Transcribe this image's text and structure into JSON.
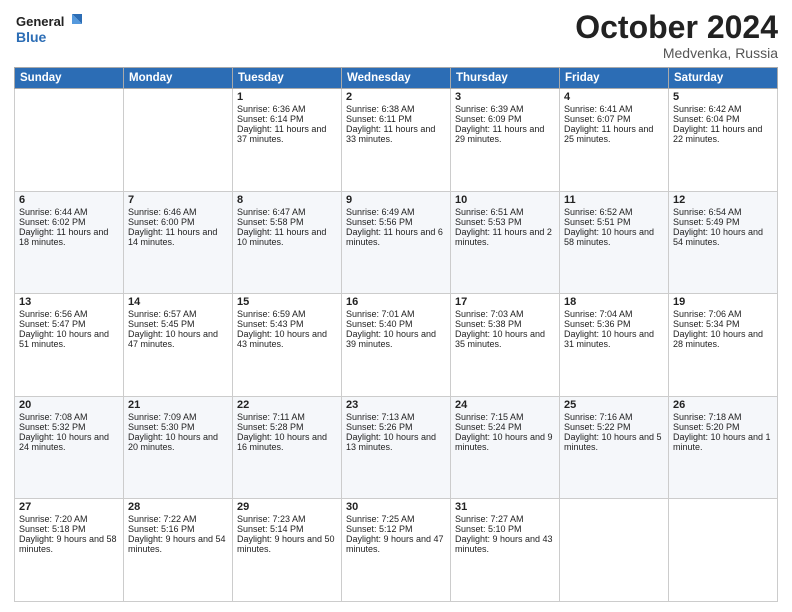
{
  "header": {
    "logo_line1": "General",
    "logo_line2": "Blue",
    "month": "October 2024",
    "location": "Medvenka, Russia"
  },
  "weekdays": [
    "Sunday",
    "Monday",
    "Tuesday",
    "Wednesday",
    "Thursday",
    "Friday",
    "Saturday"
  ],
  "weeks": [
    [
      {
        "day": "",
        "info": ""
      },
      {
        "day": "",
        "info": ""
      },
      {
        "day": "1",
        "info": "Sunrise: 6:36 AM\nSunset: 6:14 PM\nDaylight: 11 hours and 37 minutes."
      },
      {
        "day": "2",
        "info": "Sunrise: 6:38 AM\nSunset: 6:11 PM\nDaylight: 11 hours and 33 minutes."
      },
      {
        "day": "3",
        "info": "Sunrise: 6:39 AM\nSunset: 6:09 PM\nDaylight: 11 hours and 29 minutes."
      },
      {
        "day": "4",
        "info": "Sunrise: 6:41 AM\nSunset: 6:07 PM\nDaylight: 11 hours and 25 minutes."
      },
      {
        "day": "5",
        "info": "Sunrise: 6:42 AM\nSunset: 6:04 PM\nDaylight: 11 hours and 22 minutes."
      }
    ],
    [
      {
        "day": "6",
        "info": "Sunrise: 6:44 AM\nSunset: 6:02 PM\nDaylight: 11 hours and 18 minutes."
      },
      {
        "day": "7",
        "info": "Sunrise: 6:46 AM\nSunset: 6:00 PM\nDaylight: 11 hours and 14 minutes."
      },
      {
        "day": "8",
        "info": "Sunrise: 6:47 AM\nSunset: 5:58 PM\nDaylight: 11 hours and 10 minutes."
      },
      {
        "day": "9",
        "info": "Sunrise: 6:49 AM\nSunset: 5:56 PM\nDaylight: 11 hours and 6 minutes."
      },
      {
        "day": "10",
        "info": "Sunrise: 6:51 AM\nSunset: 5:53 PM\nDaylight: 11 hours and 2 minutes."
      },
      {
        "day": "11",
        "info": "Sunrise: 6:52 AM\nSunset: 5:51 PM\nDaylight: 10 hours and 58 minutes."
      },
      {
        "day": "12",
        "info": "Sunrise: 6:54 AM\nSunset: 5:49 PM\nDaylight: 10 hours and 54 minutes."
      }
    ],
    [
      {
        "day": "13",
        "info": "Sunrise: 6:56 AM\nSunset: 5:47 PM\nDaylight: 10 hours and 51 minutes."
      },
      {
        "day": "14",
        "info": "Sunrise: 6:57 AM\nSunset: 5:45 PM\nDaylight: 10 hours and 47 minutes."
      },
      {
        "day": "15",
        "info": "Sunrise: 6:59 AM\nSunset: 5:43 PM\nDaylight: 10 hours and 43 minutes."
      },
      {
        "day": "16",
        "info": "Sunrise: 7:01 AM\nSunset: 5:40 PM\nDaylight: 10 hours and 39 minutes."
      },
      {
        "day": "17",
        "info": "Sunrise: 7:03 AM\nSunset: 5:38 PM\nDaylight: 10 hours and 35 minutes."
      },
      {
        "day": "18",
        "info": "Sunrise: 7:04 AM\nSunset: 5:36 PM\nDaylight: 10 hours and 31 minutes."
      },
      {
        "day": "19",
        "info": "Sunrise: 7:06 AM\nSunset: 5:34 PM\nDaylight: 10 hours and 28 minutes."
      }
    ],
    [
      {
        "day": "20",
        "info": "Sunrise: 7:08 AM\nSunset: 5:32 PM\nDaylight: 10 hours and 24 minutes."
      },
      {
        "day": "21",
        "info": "Sunrise: 7:09 AM\nSunset: 5:30 PM\nDaylight: 10 hours and 20 minutes."
      },
      {
        "day": "22",
        "info": "Sunrise: 7:11 AM\nSunset: 5:28 PM\nDaylight: 10 hours and 16 minutes."
      },
      {
        "day": "23",
        "info": "Sunrise: 7:13 AM\nSunset: 5:26 PM\nDaylight: 10 hours and 13 minutes."
      },
      {
        "day": "24",
        "info": "Sunrise: 7:15 AM\nSunset: 5:24 PM\nDaylight: 10 hours and 9 minutes."
      },
      {
        "day": "25",
        "info": "Sunrise: 7:16 AM\nSunset: 5:22 PM\nDaylight: 10 hours and 5 minutes."
      },
      {
        "day": "26",
        "info": "Sunrise: 7:18 AM\nSunset: 5:20 PM\nDaylight: 10 hours and 1 minute."
      }
    ],
    [
      {
        "day": "27",
        "info": "Sunrise: 7:20 AM\nSunset: 5:18 PM\nDaylight: 9 hours and 58 minutes."
      },
      {
        "day": "28",
        "info": "Sunrise: 7:22 AM\nSunset: 5:16 PM\nDaylight: 9 hours and 54 minutes."
      },
      {
        "day": "29",
        "info": "Sunrise: 7:23 AM\nSunset: 5:14 PM\nDaylight: 9 hours and 50 minutes."
      },
      {
        "day": "30",
        "info": "Sunrise: 7:25 AM\nSunset: 5:12 PM\nDaylight: 9 hours and 47 minutes."
      },
      {
        "day": "31",
        "info": "Sunrise: 7:27 AM\nSunset: 5:10 PM\nDaylight: 9 hours and 43 minutes."
      },
      {
        "day": "",
        "info": ""
      },
      {
        "day": "",
        "info": ""
      }
    ]
  ]
}
